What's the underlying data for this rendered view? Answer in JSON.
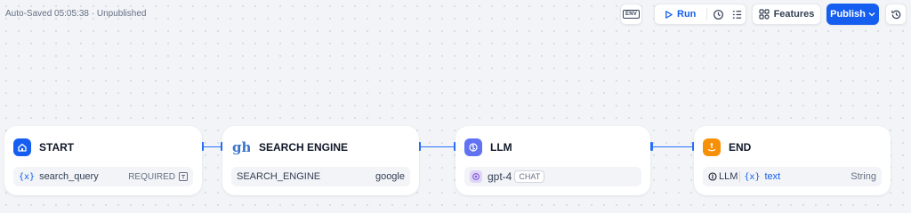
{
  "header": {
    "save_status": "Auto-Saved 05:05:38 · Unpublished",
    "env_label": "ENV",
    "run_label": "Run",
    "features_label": "Features",
    "publish_label": "Publish"
  },
  "nodes": {
    "start": {
      "title": "START",
      "variable": "search_query",
      "required_label": "REQUIRED",
      "icon": "home-icon",
      "color": "#155eef"
    },
    "search": {
      "title": "SEARCH ENGINE",
      "param_label": "SEARCH_ENGINE",
      "param_value": "google",
      "icon_text": "ght"
    },
    "llm": {
      "title": "LLM",
      "model": "gpt-4",
      "mode_tag": "CHAT",
      "icon": "brain-icon",
      "color": "#6172f3"
    },
    "end": {
      "title": "END",
      "source_node": "LLM",
      "variable": "text",
      "type_label": "String",
      "icon": "flag-icon",
      "color": "#f79009"
    }
  },
  "colors": {
    "accent": "#155eef",
    "edge": "#2970ff"
  }
}
